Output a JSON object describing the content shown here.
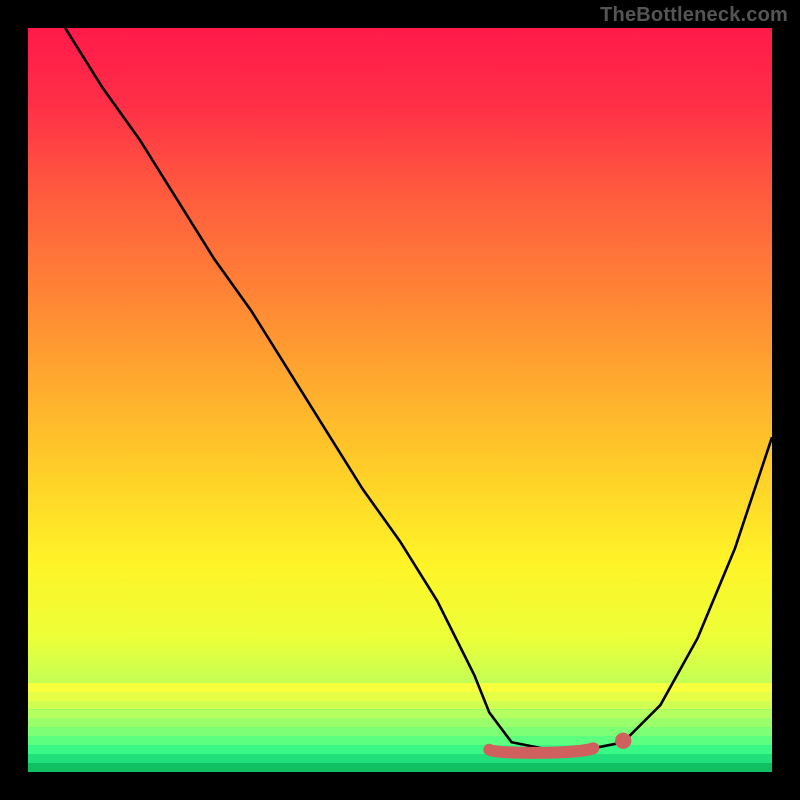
{
  "watermark": "TheBottleneck.com",
  "colors": {
    "black": "#000000",
    "curve": "#000000",
    "marker_fill": "#d0605e",
    "marker_stroke": "#d0605e"
  },
  "chart_data": {
    "type": "line",
    "title": "",
    "xlabel": "",
    "ylabel": "",
    "xlim": [
      0,
      100
    ],
    "ylim": [
      0,
      100
    ],
    "grid": false,
    "series": [
      {
        "name": "curve",
        "x": [
          5,
          10,
          15,
          20,
          25,
          30,
          35,
          40,
          45,
          50,
          55,
          60,
          62,
          65,
          70,
          75,
          80,
          85,
          90,
          95,
          100
        ],
        "y": [
          100,
          92,
          85,
          77,
          69,
          62,
          54,
          46,
          38,
          31,
          23,
          13,
          8,
          4,
          3,
          3,
          4,
          9,
          18,
          30,
          45
        ]
      }
    ],
    "highlight": {
      "name": "optimal-range",
      "x1": 62,
      "x2": 80,
      "y": 3
    },
    "gradient_stops": [
      {
        "pos": 0.0,
        "color": "#ff1a4a"
      },
      {
        "pos": 0.1,
        "color": "#ff2e47"
      },
      {
        "pos": 0.22,
        "color": "#ff5a3e"
      },
      {
        "pos": 0.35,
        "color": "#ff8236"
      },
      {
        "pos": 0.48,
        "color": "#ffab2e"
      },
      {
        "pos": 0.6,
        "color": "#ffd028"
      },
      {
        "pos": 0.72,
        "color": "#fff428"
      },
      {
        "pos": 0.82,
        "color": "#ecff38"
      },
      {
        "pos": 0.88,
        "color": "#c4ff55"
      },
      {
        "pos": 0.92,
        "color": "#99ff6a"
      },
      {
        "pos": 0.95,
        "color": "#6dff7c"
      },
      {
        "pos": 0.97,
        "color": "#36ff8a"
      },
      {
        "pos": 0.985,
        "color": "#12eb7c"
      },
      {
        "pos": 1.0,
        "color": "#0bbf62"
      }
    ],
    "bottom_bands": [
      {
        "top": 0.88,
        "h": 0.012,
        "color": "#f8ff3c"
      },
      {
        "top": 0.892,
        "h": 0.012,
        "color": "#e6ff46"
      },
      {
        "top": 0.904,
        "h": 0.012,
        "color": "#d0ff52"
      },
      {
        "top": 0.916,
        "h": 0.012,
        "color": "#b6ff60"
      },
      {
        "top": 0.928,
        "h": 0.012,
        "color": "#9bff6c"
      },
      {
        "top": 0.94,
        "h": 0.012,
        "color": "#7dff76"
      },
      {
        "top": 0.952,
        "h": 0.012,
        "color": "#5cff80"
      },
      {
        "top": 0.964,
        "h": 0.012,
        "color": "#39f986"
      },
      {
        "top": 0.976,
        "h": 0.012,
        "color": "#1fe07a"
      },
      {
        "top": 0.988,
        "h": 0.012,
        "color": "#0fbf62"
      }
    ]
  }
}
